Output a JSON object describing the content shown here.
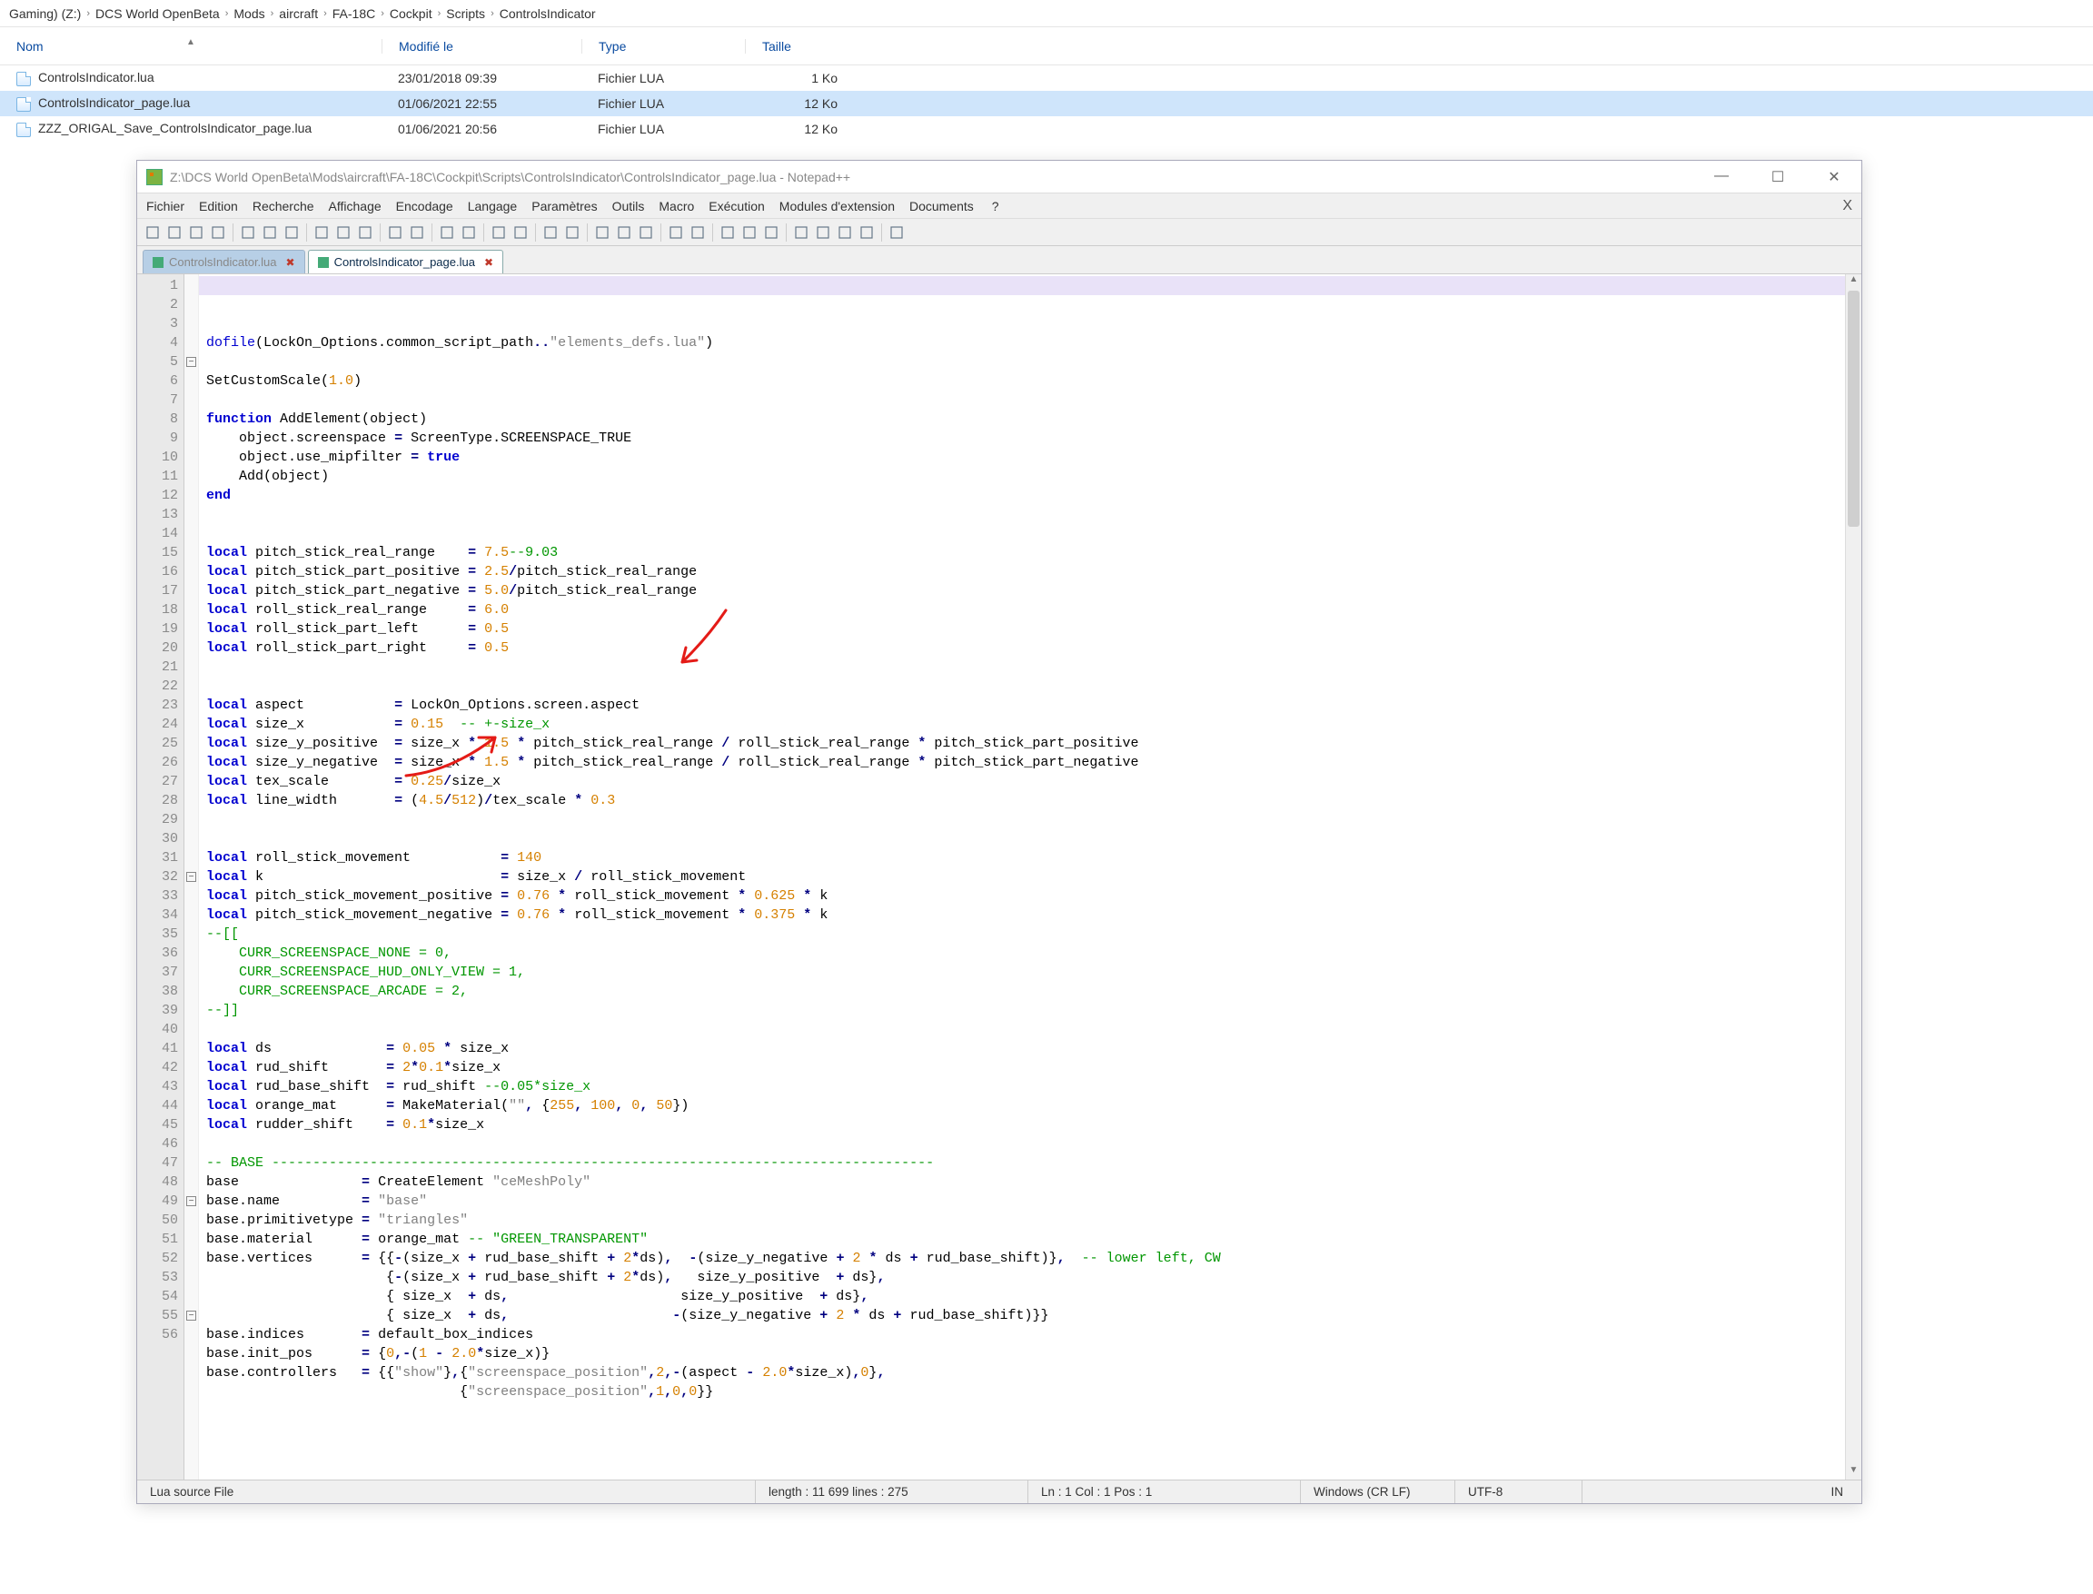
{
  "explorer": {
    "breadcrumb": [
      "Gaming) (Z:)",
      "DCS World OpenBeta",
      "Mods",
      "aircraft",
      "FA-18C",
      "Cockpit",
      "Scripts",
      "ControlsIndicator"
    ],
    "columns": {
      "name": "Nom",
      "modified": "Modifié le",
      "type": "Type",
      "size": "Taille"
    },
    "rows": [
      {
        "name": "ControlsIndicator.lua",
        "modified": "23/01/2018 09:39",
        "type": "Fichier LUA",
        "size": "1 Ko",
        "selected": false
      },
      {
        "name": "ControlsIndicator_page.lua",
        "modified": "01/06/2021 22:55",
        "type": "Fichier LUA",
        "size": "12 Ko",
        "selected": true
      },
      {
        "name": "ZZZ_ORIGAL_Save_ControlsIndicator_page.lua",
        "modified": "01/06/2021 20:56",
        "type": "Fichier LUA",
        "size": "12 Ko",
        "selected": false
      }
    ]
  },
  "notepadpp": {
    "title": "Z:\\DCS World OpenBeta\\Mods\\aircraft\\FA-18C\\Cockpit\\Scripts\\ControlsIndicator\\ControlsIndicator_page.lua - Notepad++",
    "menu": [
      "Fichier",
      "Edition",
      "Recherche",
      "Affichage",
      "Encodage",
      "Langage",
      "Paramètres",
      "Outils",
      "Macro",
      "Exécution",
      "Modules d'extension",
      "Documents",
      "?"
    ],
    "tabs": [
      {
        "label": "ControlsIndicator.lua",
        "active": false
      },
      {
        "label": "ControlsIndicator_page.lua",
        "active": true
      }
    ],
    "status": {
      "lang": "Lua source File",
      "length": "length : 11 699    lines : 275",
      "position": "Ln : 1    Col : 1    Pos : 1",
      "eol": "Windows (CR LF)",
      "encoding": "UTF-8",
      "insert": "IN"
    },
    "line_count": 56,
    "window_buttons": {
      "minimize": "—",
      "maximize": "☐",
      "close": "✕"
    }
  },
  "code_lines": [
    {
      "n": 1,
      "html": "<span class='kw2'>dofile</span><span class='paren'>(</span><span class='ident'>LockOn_Options.common_script_path</span><span class='op'>..</span><span class='str'>\"elements_defs.lua\"</span><span class='paren'>)</span>"
    },
    {
      "n": 2,
      "html": ""
    },
    {
      "n": 3,
      "html": "<span class='ident'>SetCustomScale</span><span class='paren'>(</span><span class='num'>1.0</span><span class='paren'>)</span>"
    },
    {
      "n": 4,
      "html": ""
    },
    {
      "n": 5,
      "html": "<span class='kw'>function</span> <span class='ident'>AddElement</span><span class='paren'>(</span><span class='ident'>object</span><span class='paren'>)</span>",
      "fold": "-"
    },
    {
      "n": 6,
      "html": "    <span class='ident'>object.screenspace</span> <span class='op'>=</span> <span class='ident'>ScreenType.SCREENSPACE_TRUE</span>"
    },
    {
      "n": 7,
      "html": "    <span class='ident'>object.use_mipfilter</span> <span class='op'>=</span> <span class='kw'>true</span>"
    },
    {
      "n": 8,
      "html": "    <span class='ident'>Add</span><span class='paren'>(</span><span class='ident'>object</span><span class='paren'>)</span>"
    },
    {
      "n": 9,
      "html": "<span class='kw'>end</span>"
    },
    {
      "n": 10,
      "html": ""
    },
    {
      "n": 11,
      "html": ""
    },
    {
      "n": 12,
      "html": "<span class='kw'>local</span> <span class='ident'>pitch_stick_real_range</span>    <span class='op'>=</span> <span class='num'>7.5</span><span class='cmt'>--9.03</span>"
    },
    {
      "n": 13,
      "html": "<span class='kw'>local</span> <span class='ident'>pitch_stick_part_positive</span> <span class='op'>=</span> <span class='num'>2.5</span><span class='op'>/</span><span class='ident'>pitch_stick_real_range</span>"
    },
    {
      "n": 14,
      "html": "<span class='kw'>local</span> <span class='ident'>pitch_stick_part_negative</span> <span class='op'>=</span> <span class='num'>5.0</span><span class='op'>/</span><span class='ident'>pitch_stick_real_range</span>"
    },
    {
      "n": 15,
      "html": "<span class='kw'>local</span> <span class='ident'>roll_stick_real_range</span>     <span class='op'>=</span> <span class='num'>6.0</span>"
    },
    {
      "n": 16,
      "html": "<span class='kw'>local</span> <span class='ident'>roll_stick_part_left</span>      <span class='op'>=</span> <span class='num'>0.5</span>"
    },
    {
      "n": 17,
      "html": "<span class='kw'>local</span> <span class='ident'>roll_stick_part_right</span>     <span class='op'>=</span> <span class='num'>0.5</span>"
    },
    {
      "n": 18,
      "html": ""
    },
    {
      "n": 19,
      "html": ""
    },
    {
      "n": 20,
      "html": "<span class='kw'>local</span> <span class='ident'>aspect</span>           <span class='op'>=</span> <span class='ident'>LockOn_Options.screen.aspect</span>"
    },
    {
      "n": 21,
      "html": "<span class='kw'>local</span> <span class='ident'>size_x</span>           <span class='op'>=</span> <span class='num'>0.15</span>  <span class='cmt'>-- +-size_x</span>"
    },
    {
      "n": 22,
      "html": "<span class='kw'>local</span> <span class='ident'>size_y_positive</span>  <span class='op'>=</span> <span class='ident'>size_x</span> <span class='op'>*</span> <span class='num'>1.5</span> <span class='op'>*</span> <span class='ident'>pitch_stick_real_range</span> <span class='op'>/</span> <span class='ident'>roll_stick_real_range</span> <span class='op'>*</span> <span class='ident'>pitch_stick_part_positive</span>"
    },
    {
      "n": 23,
      "html": "<span class='kw'>local</span> <span class='ident'>size_y_negative</span>  <span class='op'>=</span> <span class='ident'>size_x</span> <span class='op'>*</span> <span class='num'>1.5</span> <span class='op'>*</span> <span class='ident'>pitch_stick_real_range</span> <span class='op'>/</span> <span class='ident'>roll_stick_real_range</span> <span class='op'>*</span> <span class='ident'>pitch_stick_part_negative</span>"
    },
    {
      "n": 24,
      "html": "<span class='kw'>local</span> <span class='ident'>tex_scale</span>        <span class='op'>=</span> <span class='num'>0.25</span><span class='op'>/</span><span class='ident'>size_x</span>"
    },
    {
      "n": 25,
      "html": "<span class='kw'>local</span> <span class='ident'>line_width</span>       <span class='op'>=</span> <span class='paren'>(</span><span class='num'>4.5</span><span class='op'>/</span><span class='num'>512</span><span class='paren'>)</span><span class='op'>/</span><span class='ident'>tex_scale</span> <span class='op'>*</span> <span class='num'>0.3</span>"
    },
    {
      "n": 26,
      "html": ""
    },
    {
      "n": 27,
      "html": ""
    },
    {
      "n": 28,
      "html": "<span class='kw'>local</span> <span class='ident'>roll_stick_movement</span>           <span class='op'>=</span> <span class='num'>140</span>"
    },
    {
      "n": 29,
      "html": "<span class='kw'>local</span> <span class='ident'>k</span>                             <span class='op'>=</span> <span class='ident'>size_x</span> <span class='op'>/</span> <span class='ident'>roll_stick_movement</span>"
    },
    {
      "n": 30,
      "html": "<span class='kw'>local</span> <span class='ident'>pitch_stick_movement_positive</span> <span class='op'>=</span> <span class='num'>0.76</span> <span class='op'>*</span> <span class='ident'>roll_stick_movement</span> <span class='op'>*</span> <span class='num'>0.625</span> <span class='op'>*</span> <span class='ident'>k</span>"
    },
    {
      "n": 31,
      "html": "<span class='kw'>local</span> <span class='ident'>pitch_stick_movement_negative</span> <span class='op'>=</span> <span class='num'>0.76</span> <span class='op'>*</span> <span class='ident'>roll_stick_movement</span> <span class='op'>*</span> <span class='num'>0.375</span> <span class='op'>*</span> <span class='ident'>k</span>"
    },
    {
      "n": 32,
      "html": "<span class='cmt'>--[[</span>",
      "fold": "-"
    },
    {
      "n": 33,
      "html": "<span class='cmt'>    CURR_SCREENSPACE_NONE = 0,</span>"
    },
    {
      "n": 34,
      "html": "<span class='cmt'>    CURR_SCREENSPACE_HUD_ONLY_VIEW = 1,</span>"
    },
    {
      "n": 35,
      "html": "<span class='cmt'>    CURR_SCREENSPACE_ARCADE = 2,</span>"
    },
    {
      "n": 36,
      "html": "<span class='cmt'>--]]</span>"
    },
    {
      "n": 37,
      "html": ""
    },
    {
      "n": 38,
      "html": "<span class='kw'>local</span> <span class='ident'>ds</span>              <span class='op'>=</span> <span class='num'>0.05</span> <span class='op'>*</span> <span class='ident'>size_x</span>"
    },
    {
      "n": 39,
      "html": "<span class='kw'>local</span> <span class='ident'>rud_shift</span>       <span class='op'>=</span> <span class='num'>2</span><span class='op'>*</span><span class='num'>0.1</span><span class='op'>*</span><span class='ident'>size_x</span>"
    },
    {
      "n": 40,
      "html": "<span class='kw'>local</span> <span class='ident'>rud_base_shift</span>  <span class='op'>=</span> <span class='ident'>rud_shift</span> <span class='cmt'>--0.05*size_x</span>"
    },
    {
      "n": 41,
      "html": "<span class='kw'>local</span> <span class='ident'>orange_mat</span>      <span class='op'>=</span> <span class='ident'>MakeMaterial</span><span class='paren'>(</span><span class='str'>\"\"</span><span class='op'>,</span> <span class='paren'>{</span><span class='num'>255</span><span class='op'>,</span> <span class='num'>100</span><span class='op'>,</span> <span class='num'>0</span><span class='op'>,</span> <span class='num'>50</span><span class='paren'>}</span><span class='paren'>)</span>"
    },
    {
      "n": 42,
      "html": "<span class='kw'>local</span> <span class='ident'>rudder_shift</span>    <span class='op'>=</span> <span class='num'>0.1</span><span class='op'>*</span><span class='ident'>size_x</span>"
    },
    {
      "n": 43,
      "html": ""
    },
    {
      "n": 44,
      "html": "<span class='cmt'>-- BASE ---------------------------------------------------------------------------------</span>"
    },
    {
      "n": 45,
      "html": "<span class='ident'>base</span>               <span class='op'>=</span> <span class='ident'>CreateElement</span> <span class='str'>\"ceMeshPoly\"</span>"
    },
    {
      "n": 46,
      "html": "<span class='ident'>base.name</span>          <span class='op'>=</span> <span class='str'>\"base\"</span>"
    },
    {
      "n": 47,
      "html": "<span class='ident'>base.primitivetype</span> <span class='op'>=</span> <span class='str'>\"triangles\"</span>"
    },
    {
      "n": 48,
      "html": "<span class='ident'>base.material</span>      <span class='op'>=</span> <span class='ident'>orange_mat</span> <span class='cmt'>-- \"GREEN_TRANSPARENT\"</span>"
    },
    {
      "n": 49,
      "html": "<span class='ident'>base.vertices</span>      <span class='op'>=</span> <span class='paren'>{{</span><span class='op'>-</span><span class='paren'>(</span><span class='ident'>size_x</span> <span class='op'>+</span> <span class='ident'>rud_base_shift</span> <span class='op'>+</span> <span class='num'>2</span><span class='op'>*</span><span class='ident'>ds</span><span class='paren'>)</span><span class='op'>,</span>  <span class='op'>-</span><span class='paren'>(</span><span class='ident'>size_y_negative</span> <span class='op'>+</span> <span class='num'>2</span> <span class='op'>*</span> <span class='ident'>ds</span> <span class='op'>+</span> <span class='ident'>rud_base_shift</span><span class='paren'>)}</span><span class='op'>,</span>  <span class='cmt'>-- lower left, CW</span>",
      "fold": "-"
    },
    {
      "n": 50,
      "html": "                      <span class='paren'>{</span><span class='op'>-</span><span class='paren'>(</span><span class='ident'>size_x</span> <span class='op'>+</span> <span class='ident'>rud_base_shift</span> <span class='op'>+</span> <span class='num'>2</span><span class='op'>*</span><span class='ident'>ds</span><span class='paren'>)</span><span class='op'>,</span>   <span class='ident'>size_y_positive</span>  <span class='op'>+</span> <span class='ident'>ds</span><span class='paren'>}</span><span class='op'>,</span>"
    },
    {
      "n": 51,
      "html": "                      <span class='paren'>{</span> <span class='ident'>size_x</span>  <span class='op'>+</span> <span class='ident'>ds</span><span class='op'>,</span>                     <span class='ident'>size_y_positive</span>  <span class='op'>+</span> <span class='ident'>ds</span><span class='paren'>}</span><span class='op'>,</span>"
    },
    {
      "n": 52,
      "html": "                      <span class='paren'>{</span> <span class='ident'>size_x</span>  <span class='op'>+</span> <span class='ident'>ds</span><span class='op'>,</span>                    <span class='op'>-</span><span class='paren'>(</span><span class='ident'>size_y_negative</span> <span class='op'>+</span> <span class='num'>2</span> <span class='op'>*</span> <span class='ident'>ds</span> <span class='op'>+</span> <span class='ident'>rud_base_shift</span><span class='paren'>)}}</span>"
    },
    {
      "n": 53,
      "html": "<span class='ident'>base.indices</span>       <span class='op'>=</span> <span class='ident'>default_box_indices</span>"
    },
    {
      "n": 54,
      "html": "<span class='ident'>base.init_pos</span>      <span class='op'>=</span> <span class='paren'>{</span><span class='num'>0</span><span class='op'>,-</span><span class='paren'>(</span><span class='num'>1</span> <span class='op'>-</span> <span class='num'>2.0</span><span class='op'>*</span><span class='ident'>size_x</span><span class='paren'>)}</span>"
    },
    {
      "n": 55,
      "html": "<span class='ident'>base.controllers</span>   <span class='op'>=</span> <span class='paren'>{{</span><span class='str'>\"show\"</span><span class='paren'>}</span><span class='op'>,</span><span class='paren'>{</span><span class='str'>\"screenspace_position\"</span><span class='op'>,</span><span class='num'>2</span><span class='op'>,-</span><span class='paren'>(</span><span class='ident'>aspect</span> <span class='op'>-</span> <span class='num'>2.0</span><span class='op'>*</span><span class='ident'>size_x</span><span class='paren'>)</span><span class='op'>,</span><span class='num'>0</span><span class='paren'>}</span><span class='op'>,</span>",
      "fold": "-"
    },
    {
      "n": 56,
      "html": "                               <span class='paren'>{</span><span class='str'>\"screenspace_position\"</span><span class='op'>,</span><span class='num'>1</span><span class='op'>,</span><span class='num'>0</span><span class='op'>,</span><span class='num'>0</span><span class='paren'>}}</span>"
    }
  ]
}
